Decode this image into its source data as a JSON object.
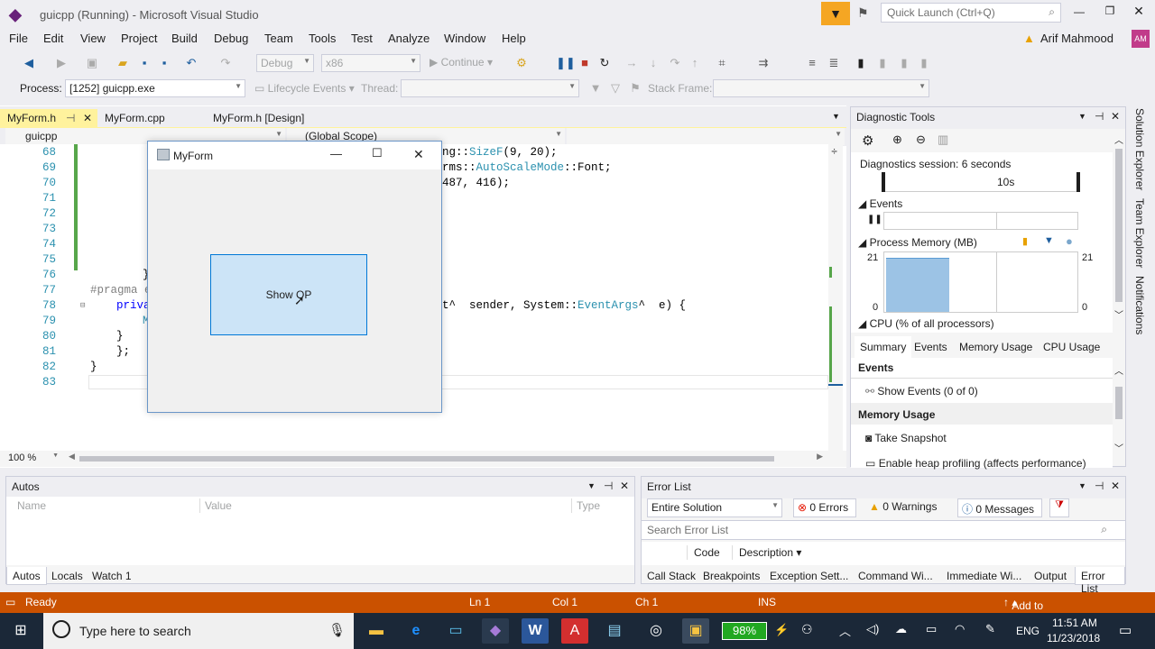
{
  "window": {
    "title": "guicpp (Running) - Microsoft Visual Studio"
  },
  "quick_launch": {
    "placeholder": "Quick Launch (Ctrl+Q)"
  },
  "user": {
    "name": "Arif Mahmood",
    "initials": "AM"
  },
  "menu": [
    "File",
    "Edit",
    "View",
    "Project",
    "Build",
    "Debug",
    "Team",
    "Tools",
    "Test",
    "Analyze",
    "Window",
    "Help"
  ],
  "toolbar": {
    "config": "Debug",
    "platform": "x86",
    "continue_label": "Continue",
    "process_label": "Process:",
    "process_value": "[1252] guicpp.exe",
    "lifecycle_label": "Lifecycle Events",
    "thread_label": "Thread:",
    "stack_frame_label": "Stack Frame:"
  },
  "tabs": [
    {
      "label": "MyForm.h",
      "active": true
    },
    {
      "label": "MyForm.cpp"
    },
    {
      "label": "MyForm.h [Design]"
    }
  ],
  "nav": {
    "project": "guicpp",
    "scope": "(Global Scope)"
  },
  "code": {
    "lines": [
      "68",
      "69",
      "70",
      "71",
      "72",
      "73",
      "74",
      "75",
      "76",
      "77",
      "78",
      "79",
      "80",
      "81",
      "82",
      "83"
    ],
    "l68_a": "ng::",
    "l68_b": "SizeF",
    "l68_c": "(9, 20);",
    "l69_a": "rms::",
    "l69_b": "AutoScaleMode",
    "l69_c": "::Font;",
    "l70": "487, 416);",
    "l76": "}",
    "l77": "#pragma e",
    "l78_kw": "priva",
    "l78_rest_a": "t^  sender, System::",
    "l78_type": "EventArgs",
    "l78_rest_b": "^  e) {",
    "l79": "M",
    "l80": "}",
    "l81": "};",
    "l82": "}"
  },
  "zoom": "100 %",
  "form": {
    "title": "MyForm",
    "button_label": "Show OP"
  },
  "diagnostics": {
    "title": "Diagnostic Tools",
    "session": "Diagnostics session: 6 seconds",
    "timeline_mark": "10s",
    "events_label": "Events",
    "memory_label": "Process Memory (MB)",
    "mem_max": "21",
    "mem_min": "0",
    "cpu_label": "CPU (% of all processors)",
    "tabs": [
      "Summary",
      "Events",
      "Memory Usage",
      "CPU Usage"
    ],
    "events_section": "Events",
    "show_events": "Show Events (0 of 0)",
    "memory_section": "Memory Usage",
    "take_snapshot": "Take Snapshot",
    "heap_profiling": "Enable heap profiling (affects performance)"
  },
  "side_tabs": [
    "Solution Explorer",
    "Team Explorer",
    "Notifications"
  ],
  "autos": {
    "title": "Autos",
    "columns": [
      "Name",
      "Value",
      "Type"
    ],
    "tabs": [
      "Autos",
      "Locals",
      "Watch 1"
    ]
  },
  "errors": {
    "title": "Error List",
    "scope": "Entire Solution",
    "errors": "0 Errors",
    "warnings": "0 Warnings",
    "messages": "0 Messages",
    "search_placeholder": "Search Error List",
    "columns": [
      "Code",
      "Description"
    ],
    "tabs": [
      "Call Stack",
      "Breakpoints",
      "Exception Sett...",
      "Command Wi...",
      "Immediate Wi...",
      "Output",
      "Error List"
    ]
  },
  "status": {
    "ready": "Ready",
    "ln": "Ln 1",
    "col": "Col 1",
    "ch": "Ch 1",
    "ins": "INS",
    "source_control": "Add to Source Control"
  },
  "taskbar": {
    "search_placeholder": "Type here to search",
    "battery": "98%",
    "lang": "ENG",
    "time": "11:51 AM",
    "date": "11/23/2018"
  },
  "colors": {
    "accent": "#007ACC",
    "status": "#CA5100",
    "taskbar": "#1B2838",
    "active_tab": "#FFF29D"
  }
}
